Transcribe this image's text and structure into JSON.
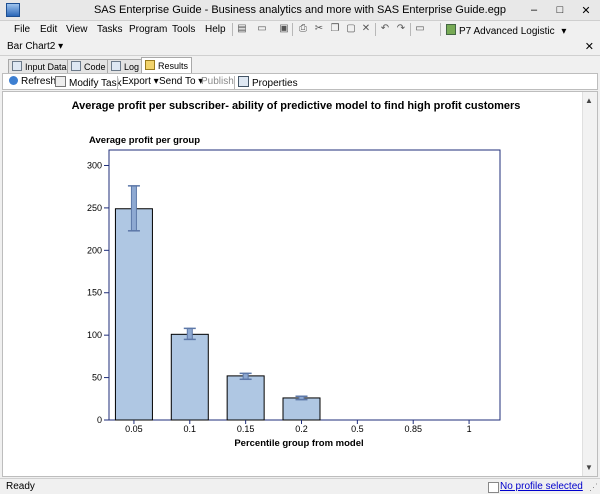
{
  "window": {
    "title": "SAS Enterprise Guide - Business analytics and more with SAS Enterprise Guide.egp",
    "minimize": "–",
    "maximize": "□",
    "close": "✕"
  },
  "menu": [
    "File",
    "Edit",
    "View",
    "Tasks",
    "Program",
    "Tools",
    "Help"
  ],
  "toolbar": {
    "icons": [
      "new-icon",
      "open-icon",
      "save-icon",
      "print-icon",
      "cut-icon",
      "copy-icon",
      "paste-icon",
      "delete-icon",
      "undo-icon",
      "redo-icon",
      "window-icon"
    ],
    "project_label": "P7 Advanced Logistic",
    "project_dropdown": "▾"
  },
  "document": {
    "title": "Bar Chart2",
    "close": "✕"
  },
  "tabs": [
    "Input Data",
    "Code",
    "Log",
    "Results"
  ],
  "active_tab": "Results",
  "results_toolbar": {
    "refresh": "Refresh",
    "modify_task": "Modify Task",
    "export": "Export",
    "send_to": "Send To",
    "publish": "Publish",
    "properties": "Properties"
  },
  "status": {
    "text": "Ready",
    "profile": "No profile selected"
  },
  "chart_data": {
    "type": "bar",
    "title": "Average profit per subscriber- ability of predictive model to find high profit customers",
    "ylabel": "Average profit per group",
    "xlabel": "Percentile group from model",
    "categories": [
      "0.05",
      "0.1",
      "0.15",
      "0.2",
      "0.5",
      "0.85",
      "1"
    ],
    "values": [
      249,
      101,
      52,
      26,
      0,
      0,
      0
    ],
    "error_low": [
      223,
      95,
      48,
      24,
      0,
      0,
      0
    ],
    "error_high": [
      276,
      108,
      55,
      28,
      0,
      0,
      0
    ],
    "ylim": [
      0,
      310
    ],
    "yticks": [
      0,
      50,
      100,
      150,
      200,
      250,
      300
    ],
    "grid": false,
    "colors": {
      "bar_fill": "#afc7e3",
      "bar_stroke": "#000000",
      "error_bar": "#5d78a8",
      "frame": "#1f2e7a"
    }
  }
}
